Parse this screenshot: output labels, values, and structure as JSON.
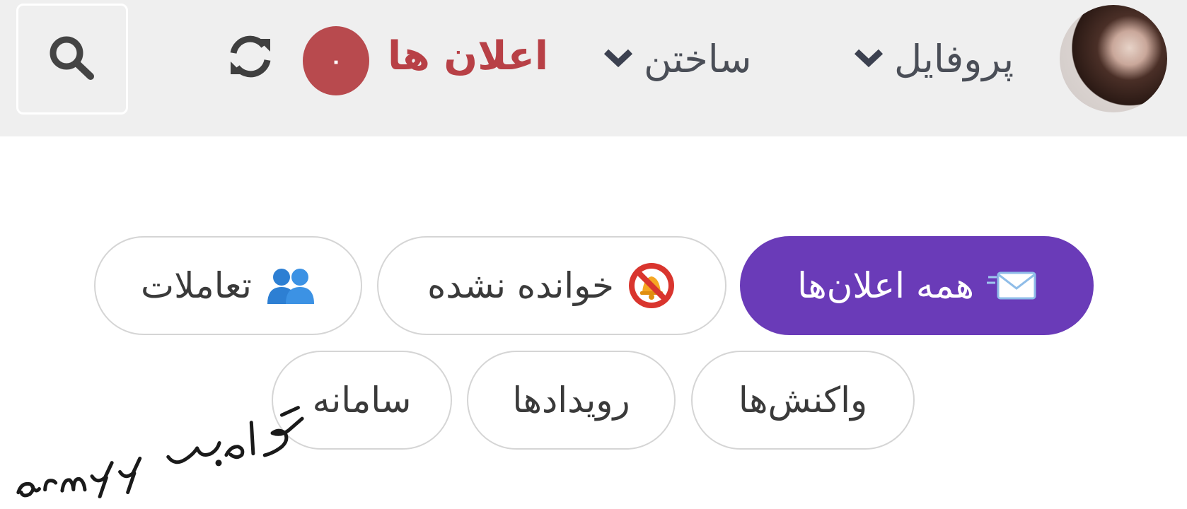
{
  "topbar": {
    "search": {
      "icon": "search-icon"
    },
    "refresh": {
      "icon": "refresh-icon"
    },
    "notifications": {
      "label": "اعلان ها",
      "count": "۰",
      "color": "#b84046",
      "badge_color": "#b84a4e"
    },
    "create": {
      "label": "ساختن",
      "icon": "chevron-down-icon"
    },
    "profile": {
      "label": "پروفایل",
      "icon": "chevron-down-icon"
    },
    "avatar": {
      "icon": "user-avatar"
    }
  },
  "filters": {
    "accent": "#6a3bb8",
    "items": [
      {
        "label": "همه اعلان‌ها",
        "icon": "envelope-icon",
        "active": true
      },
      {
        "label": "خوانده نشده",
        "icon": "bell-muted-icon",
        "active": false
      },
      {
        "label": "تعاملات",
        "icon": "people-icon",
        "active": false
      },
      {
        "label": "واکنش‌ها",
        "active": false
      },
      {
        "label": "رویدادها",
        "active": false
      },
      {
        "label": "سامانه",
        "active": false
      }
    ]
  },
  "watermark": {
    "handwritten": "کاربر armyy"
  }
}
